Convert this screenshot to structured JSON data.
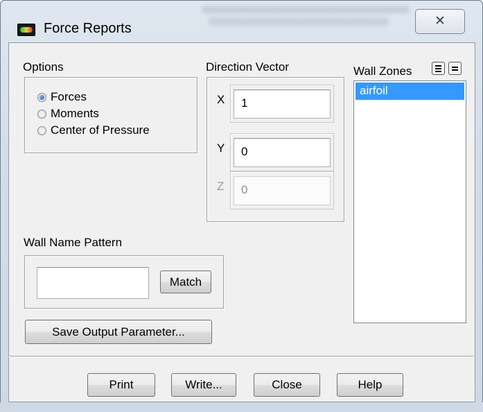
{
  "window": {
    "title": "Force Reports",
    "close_glyph": "✕"
  },
  "options": {
    "label": "Options",
    "radios": [
      {
        "label": "Forces",
        "selected": true
      },
      {
        "label": "Moments",
        "selected": false
      },
      {
        "label": "Center of Pressure",
        "selected": false
      }
    ]
  },
  "direction_vector": {
    "label": "Direction Vector",
    "x_label": "X",
    "x_value": "1",
    "y_label": "Y",
    "y_value": "0",
    "z_label": "Z",
    "z_value": "0"
  },
  "wall_zones": {
    "label": "Wall Zones",
    "items": [
      "airfoil"
    ],
    "selected_item": "airfoil",
    "select_all_icon": "select-all-icon",
    "deselect_all_icon": "deselect-all-icon"
  },
  "wall_name_pattern": {
    "label": "Wall Name Pattern",
    "value": "",
    "match_label": "Match"
  },
  "save_output_parameter_label": "Save Output Parameter...",
  "footer": {
    "print_label": "Print",
    "write_label": "Write...",
    "close_label": "Close",
    "help_label": "Help"
  },
  "colors": {
    "selection": "#3399ff",
    "dialog_background": "#f0f0f0"
  }
}
